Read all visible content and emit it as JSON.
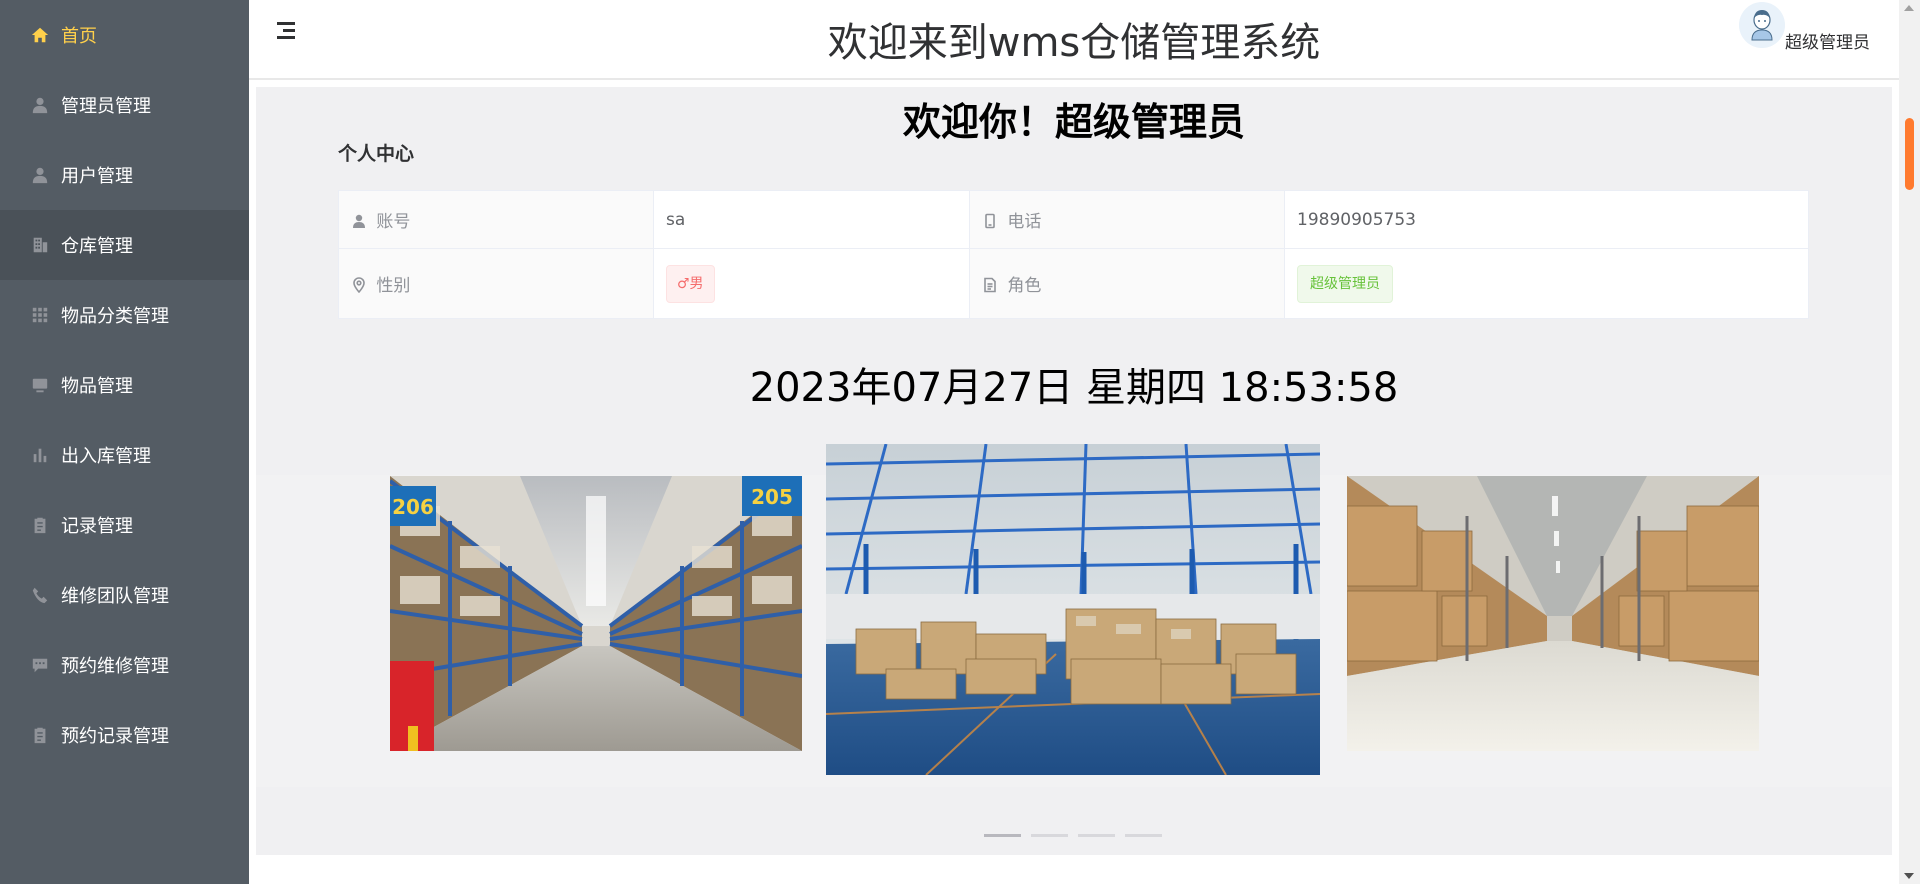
{
  "sidebar": {
    "items": [
      {
        "label": "首页",
        "icon": "home-icon"
      },
      {
        "label": "管理员管理",
        "icon": "user-icon"
      },
      {
        "label": "用户管理",
        "icon": "user-icon"
      },
      {
        "label": "仓库管理",
        "icon": "office-building-icon"
      },
      {
        "label": "物品分类管理",
        "icon": "grid-icon"
      },
      {
        "label": "物品管理",
        "icon": "goods-icon"
      },
      {
        "label": "出入库管理",
        "icon": "histogram-icon"
      },
      {
        "label": "记录管理",
        "icon": "clipboard-icon"
      },
      {
        "label": "维修团队管理",
        "icon": "phone-icon"
      },
      {
        "label": "预约维修管理",
        "icon": "chat-icon"
      },
      {
        "label": "预约记录管理",
        "icon": "clipboard-icon"
      }
    ],
    "colors": {
      "background": "#545c64",
      "active_text": "#ffd04b",
      "text": "#ffffff"
    }
  },
  "header": {
    "title": "欢迎来到wms仓储管理系统",
    "user_name": "超级管理员"
  },
  "main": {
    "welcome": "欢迎你！超级管理员",
    "section_title": "个人中心",
    "profile": {
      "account_label": "账号",
      "account_value": "sa",
      "phone_label": "电话",
      "phone_value": "19890905753",
      "gender_label": "性别",
      "gender_value": "♂男",
      "role_label": "角色",
      "role_value": "超级管理员"
    },
    "datetime": "2023年07月27日 星期四 18:53:58",
    "carousel": {
      "slide_count": 4,
      "active_index": 0
    }
  }
}
